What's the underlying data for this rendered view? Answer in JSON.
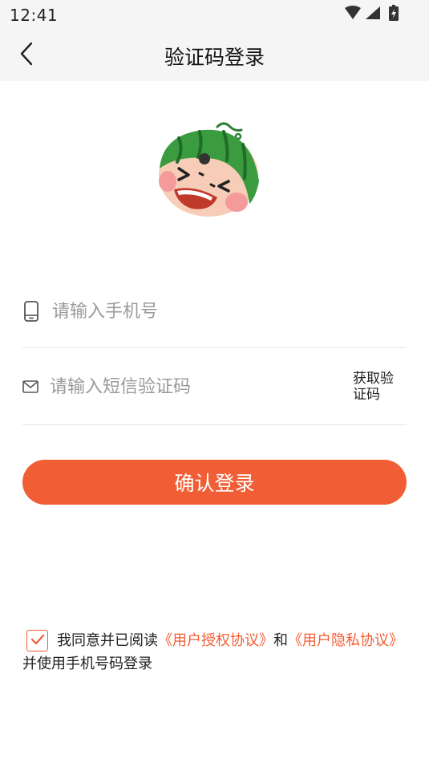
{
  "status_bar": {
    "time": "12:41",
    "icons": [
      "wifi-icon",
      "cellular-signal-icon",
      "battery-icon"
    ]
  },
  "header": {
    "back_icon": "chevron-left-icon",
    "title": "验证码登录"
  },
  "logo": {
    "icon": "watermelon-mascot-icon"
  },
  "form": {
    "phone": {
      "icon": "phone-icon",
      "value": "",
      "placeholder": "请输入手机号"
    },
    "code": {
      "icon": "mail-icon",
      "value": "",
      "placeholder": "请输入短信验证码",
      "get_code_label": "获取验证码"
    },
    "submit_label": "确认登录"
  },
  "agreement": {
    "checked": true,
    "prefix": "我同意并已阅读",
    "user_agreement_link": "《用户授权协议》",
    "and": "和",
    "privacy_link": "《用户隐私协议》",
    "suffix": "并使用手机号码登录"
  },
  "colors": {
    "accent": "#f15d35",
    "header_bg": "#f5f5f5",
    "divider": "#e5e5e5",
    "placeholder": "#9a9a9a"
  }
}
